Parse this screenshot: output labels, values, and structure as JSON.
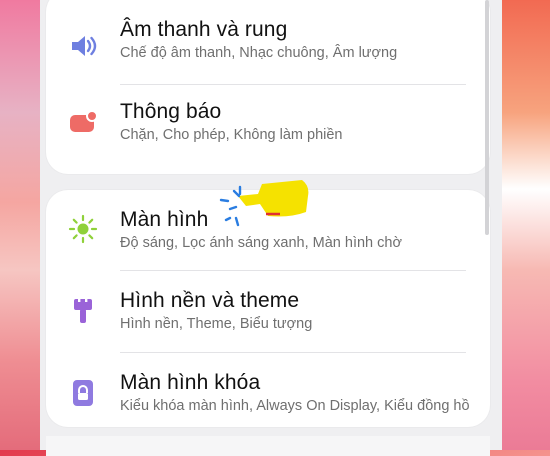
{
  "settings": {
    "sound_group": [
      {
        "title": "Âm thanh và rung",
        "subtitle": "Chế độ âm thanh, Nhạc chuông, Âm lượng",
        "icon": "volume-icon",
        "color": "#6e7fe0"
      },
      {
        "title": "Thông báo",
        "subtitle": "Chặn, Cho phép, Không làm phiền",
        "icon": "notification-icon",
        "color": "#ee6b66"
      }
    ],
    "display_group": [
      {
        "title": "Màn hình",
        "subtitle": "Độ sáng, Lọc ánh sáng xanh, Màn hình chờ",
        "icon": "brightness-icon",
        "color": "#8fd13a"
      },
      {
        "title": "Hình nền và theme",
        "subtitle": "Hình nền, Theme, Biểu tượng",
        "icon": "paintbrush-icon",
        "color": "#9a63d8"
      },
      {
        "title": "Màn hình khóa",
        "subtitle": "Kiểu khóa màn hình, Always On Display, Kiểu đồng hồ",
        "icon": "lock-icon",
        "color": "#8f7ae0"
      }
    ]
  },
  "annotation": {
    "icon": "tap-indicator-icon",
    "highlight_color": "#f5e200",
    "sparkle_color": "#2a7de1",
    "mark_color": "#e03030"
  }
}
